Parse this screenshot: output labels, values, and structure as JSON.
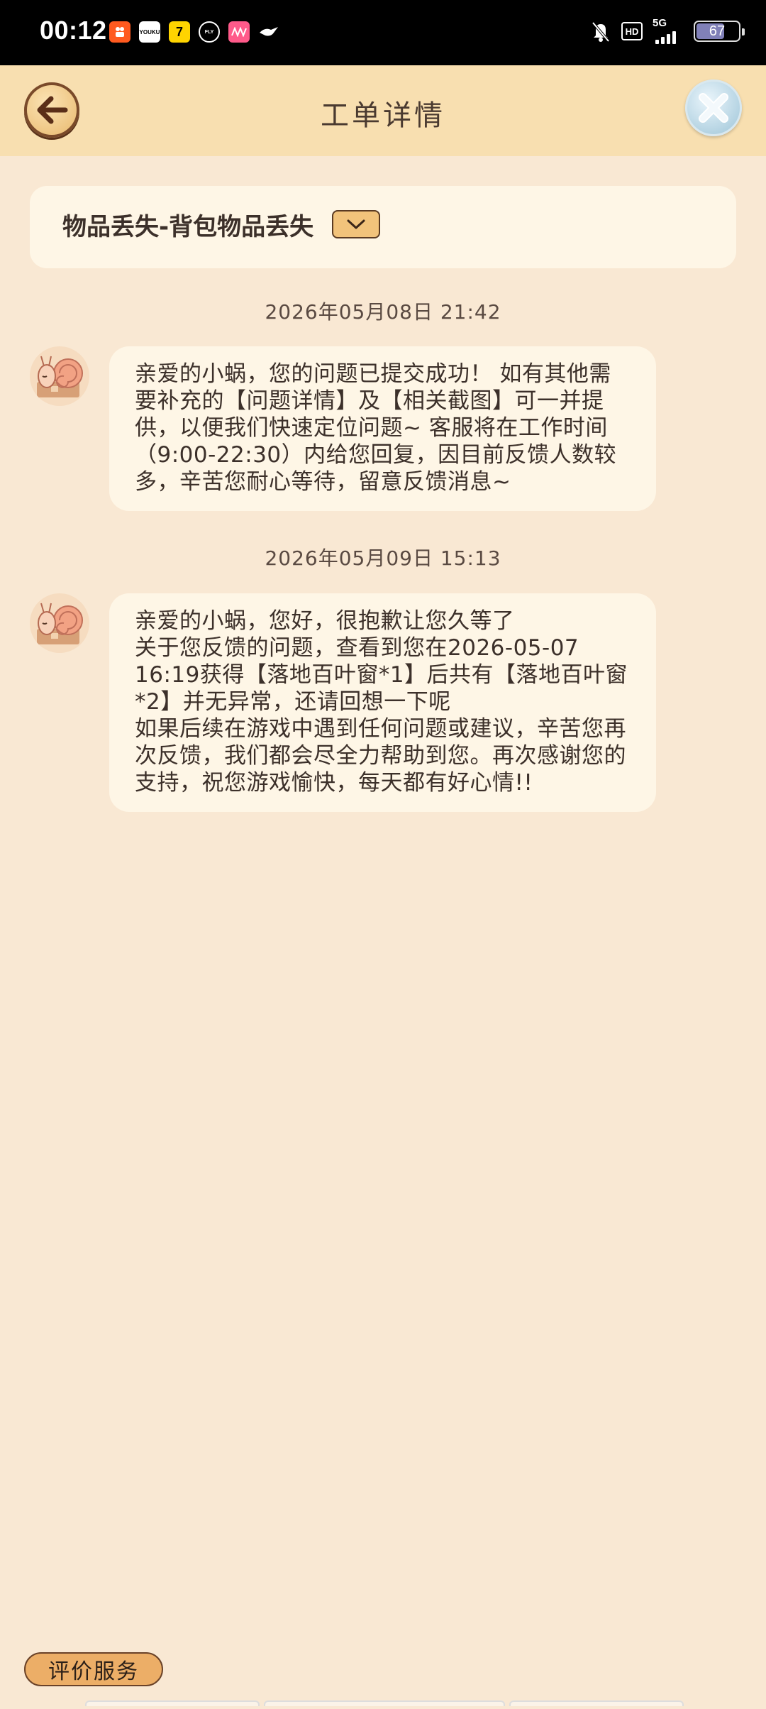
{
  "status_bar": {
    "time": "00:12",
    "apps": [
      {
        "name": "kuaishou-app-icon",
        "color": "#ff5a1f",
        "label": ""
      },
      {
        "name": "youku-app-icon",
        "color": "#ffffff",
        "label": "YOUKU"
      },
      {
        "name": "qimao-app-icon",
        "color": "#ffd400",
        "label": "7"
      },
      {
        "name": "fly-app-icon",
        "color": "#000000",
        "label": "FLY"
      },
      {
        "name": "video-app-icon",
        "color": "#ff5a8a",
        "label": ""
      },
      {
        "name": "bird-app-icon",
        "color": "#000000",
        "label": ""
      }
    ],
    "network": "5G",
    "battery": "67",
    "battery_level": 0.67
  },
  "header": {
    "title": "工单详情"
  },
  "ticket": {
    "category": "物品丢失-背包物品丢失"
  },
  "messages": [
    {
      "timestamp": "2026年05月08日 21:42",
      "text": "亲爱的小蜗，您的问题已提交成功！ 如有其他需要补充的【问题详情】及【相关截图】可一并提供，以便我们快速定位问题~ 客服将在工作时间（9:00-22:30）内给您回复，因目前反馈人数较多，辛苦您耐心等待，留意反馈消息~"
    },
    {
      "timestamp": "2026年05月09日 15:13",
      "text": "亲爱的小蜗，您好，很抱歉让您久等了\n关于您反馈的问题，查看到您在2026-05-07 16:19获得【落地百叶窗*1】后共有【落地百叶窗*2】并无异常，还请回想一下呢\n如果后续在游戏中遇到任何问题或建议，辛苦您再次反馈，我们都会尽全力帮助到您。再次感谢您的支持，祝您游戏愉快，每天都有好心情!!"
    }
  ],
  "footer": {
    "rate_label": "评价服务"
  },
  "colors": {
    "background": "#f9e8d3",
    "header": "#f8dfb0",
    "card": "#fef6e6",
    "button": "#ecae67"
  }
}
